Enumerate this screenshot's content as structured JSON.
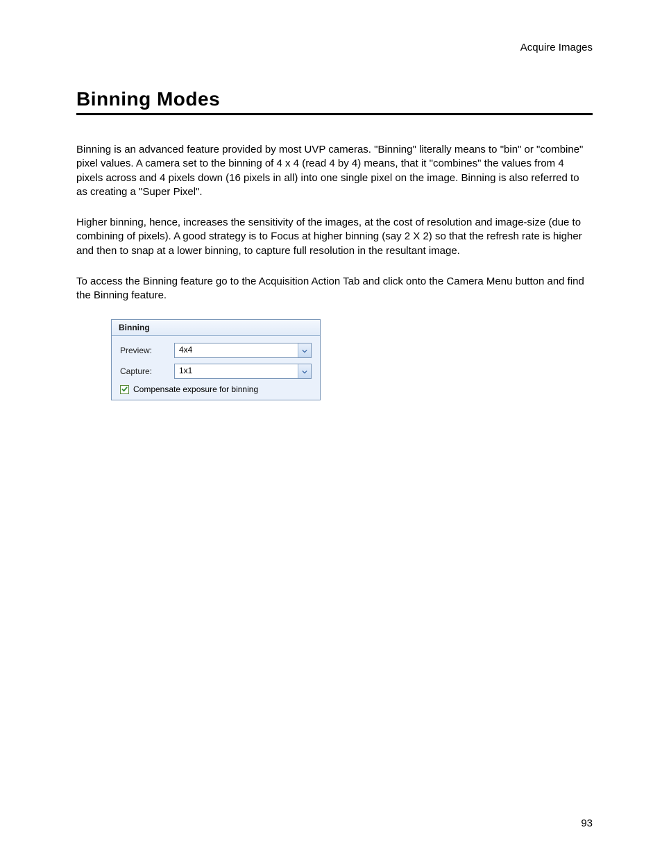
{
  "header": {
    "breadcrumb": "Acquire Images"
  },
  "section": {
    "title": "Binning Modes"
  },
  "paragraphs": {
    "p1": "Binning is an advanced feature provided by most UVP cameras. \"Binning\" literally means to \"bin\" or \"combine\" pixel values. A camera set to the binning of 4 x 4 (read 4 by 4) means, that it \"combines\" the values from 4 pixels across and 4 pixels down (16 pixels in all) into one single pixel on the image. Binning is also referred to as creating a \"Super Pixel\".",
    "p2": "Higher binning, hence, increases the sensitivity of the images, at the cost of resolution and image-size (due to combining of pixels). A good strategy is to Focus at higher binning (say 2 X 2) so that the refresh rate is higher and then to snap at a lower binning, to capture full resolution in the resultant image.",
    "p3": "To access the Binning feature go to the Acquisition Action Tab and click onto the Camera Menu button and find the Binning feature."
  },
  "panel": {
    "title": "Binning",
    "preview_label": "Preview:",
    "preview_value": "4x4",
    "capture_label": "Capture:",
    "capture_value": "1x1",
    "checkbox_label": "Compensate exposure for binning",
    "checkbox_checked": true
  },
  "footer": {
    "page_number": "93"
  }
}
